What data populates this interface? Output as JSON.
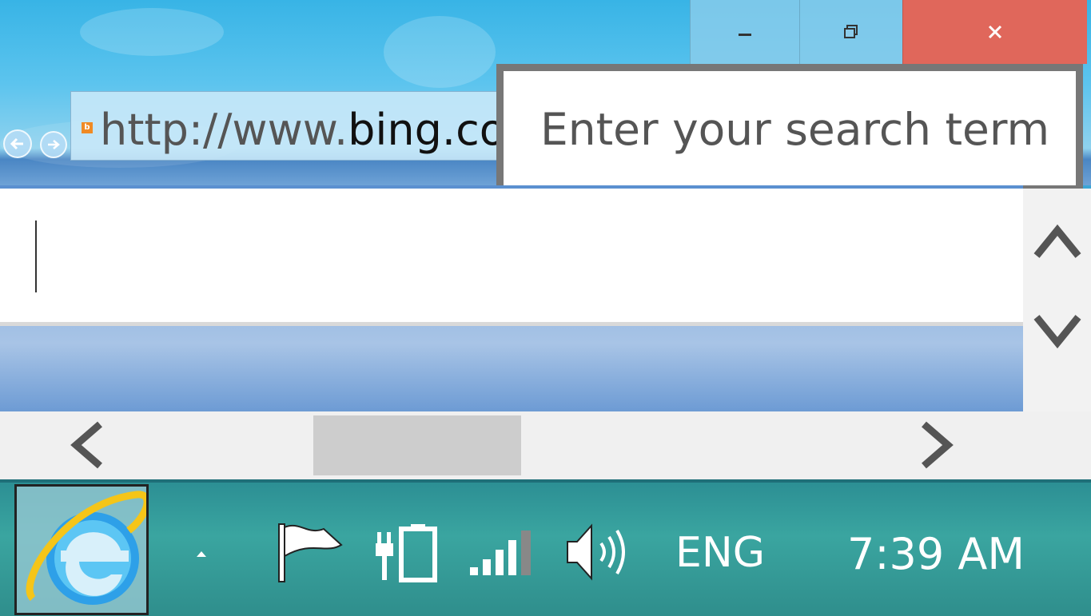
{
  "window": {
    "minimize_icon": "minimize-icon",
    "restore_icon": "restore-icon",
    "close_icon": "close-icon",
    "close_color": "#e0675b"
  },
  "browser": {
    "back_icon": "back-arrow-icon",
    "forward_icon": "forward-arrow-icon",
    "address": {
      "prefix": "http://www.",
      "domain": "bing.co"
    }
  },
  "search_popup": {
    "placeholder": "Enter your search term"
  },
  "editor": {
    "value": ""
  },
  "scrollbars": {
    "up_icon": "chevron-up-icon",
    "down_icon": "chevron-down-icon",
    "left_icon": "chevron-left-icon",
    "right_icon": "chevron-right-icon"
  },
  "taskbar": {
    "pinned_app": "internet-explorer-icon",
    "tray_overflow_icon": "show-hidden-icons-icon",
    "tray_icons": [
      "action-center-flag-icon",
      "power-battery-icon",
      "network-signal-icon",
      "volume-icon"
    ],
    "language": "ENG",
    "clock": "7:39 AM"
  }
}
